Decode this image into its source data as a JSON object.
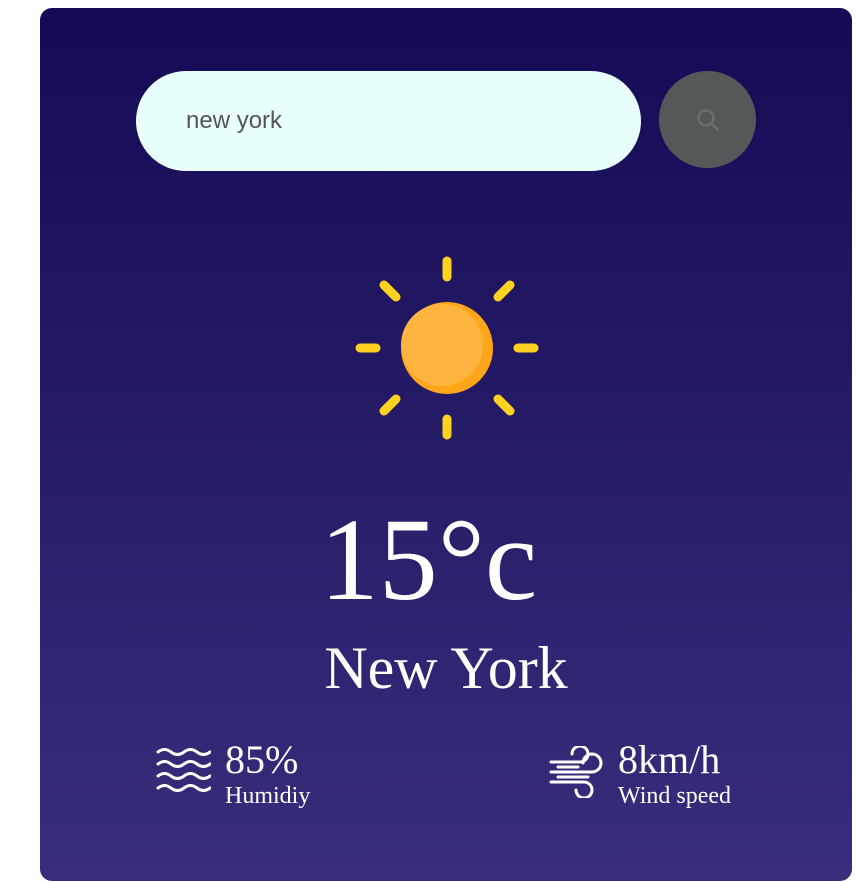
{
  "search": {
    "value": "new york",
    "button_icon": "search-icon"
  },
  "weather": {
    "icon": "sun-icon",
    "temperature": "15°c",
    "city": "New York"
  },
  "details": {
    "humidity": {
      "icon": "waves-icon",
      "value": "85%",
      "label": "Humidiy"
    },
    "wind": {
      "icon": "wind-icon",
      "value": "8km/h",
      "label": "Wind speed"
    }
  },
  "colors": {
    "card_top": "#140a55",
    "card_bottom": "#382e7c",
    "search_bg": "#e9fffd",
    "search_button": "#555858",
    "sun_rays": "#ffd21f",
    "sun_body": "#ffad3b"
  }
}
